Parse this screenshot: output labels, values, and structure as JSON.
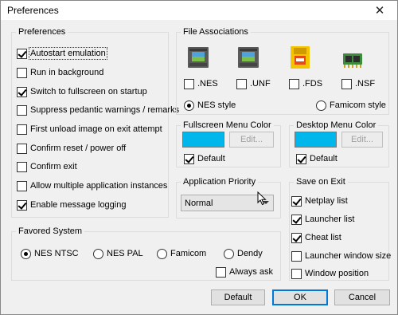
{
  "window": {
    "title": "Preferences",
    "close_glyph": "✕"
  },
  "preferences": {
    "title": "Preferences",
    "items": [
      {
        "label": "Autostart emulation",
        "checked": true
      },
      {
        "label": "Run in background",
        "checked": false
      },
      {
        "label": "Switch to fullscreen on startup",
        "checked": true
      },
      {
        "label": "Suppress pedantic warnings / remarks",
        "checked": false
      },
      {
        "label": "First unload image on exit attempt",
        "checked": false
      },
      {
        "label": "Confirm reset / power off",
        "checked": false
      },
      {
        "label": "Confirm exit",
        "checked": false
      },
      {
        "label": "Allow multiple application instances",
        "checked": false
      },
      {
        "label": "Enable message logging",
        "checked": true
      }
    ]
  },
  "file_associations": {
    "title": "File Associations",
    "items": [
      {
        "label": ".NES",
        "checked": false,
        "icon": "nes-cartridge-icon"
      },
      {
        "label": ".UNF",
        "checked": false,
        "icon": "unf-cartridge-icon"
      },
      {
        "label": ".FDS",
        "checked": false,
        "icon": "fds-disk-icon"
      },
      {
        "label": ".NSF",
        "checked": false,
        "icon": "nsf-chip-icon"
      }
    ],
    "style_options": [
      {
        "label": "NES style",
        "selected": true
      },
      {
        "label": "Famicom style",
        "selected": false
      }
    ]
  },
  "fullscreen_menu_color": {
    "title": "Fullscreen Menu Color",
    "color": "#00b7eb",
    "edit_label": "Edit...",
    "default_label": "Default",
    "default_checked": true
  },
  "desktop_menu_color": {
    "title": "Desktop Menu Color",
    "color": "#00b7eb",
    "edit_label": "Edit...",
    "default_label": "Default",
    "default_checked": true
  },
  "application_priority": {
    "title": "Application Priority",
    "value": "Normal"
  },
  "save_on_exit": {
    "title": "Save on Exit",
    "items": [
      {
        "label": "Netplay list",
        "checked": true
      },
      {
        "label": "Launcher list",
        "checked": true
      },
      {
        "label": "Cheat list",
        "checked": true
      },
      {
        "label": "Launcher window size",
        "checked": false
      },
      {
        "label": "Window position",
        "checked": false
      }
    ]
  },
  "favored_system": {
    "title": "Favored System",
    "options": [
      {
        "label": "NES NTSC",
        "selected": true
      },
      {
        "label": "NES PAL",
        "selected": false
      },
      {
        "label": "Famicom",
        "selected": false
      },
      {
        "label": "Dendy",
        "selected": false
      }
    ],
    "always_ask_label": "Always ask",
    "always_ask_checked": false
  },
  "buttons": {
    "default_label": "Default",
    "ok_label": "OK",
    "cancel_label": "Cancel"
  },
  "colors": {
    "accent": "#0078d7",
    "swatch": "#00b7eb"
  }
}
